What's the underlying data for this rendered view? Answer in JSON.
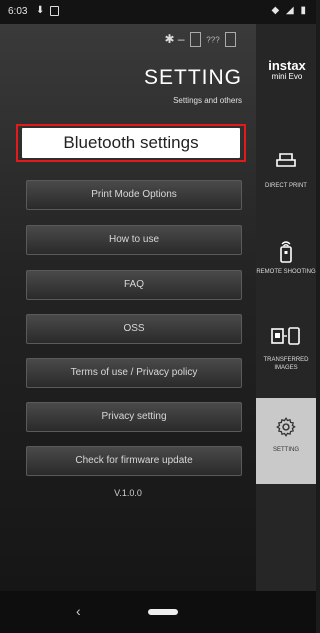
{
  "status_bar": {
    "time": "6:03",
    "download_icon": "⬇",
    "right_icons": "◆ ◢ ▮"
  },
  "header": {
    "device_text": "???",
    "title": "SETTING",
    "subtitle": "Settings and others"
  },
  "brand": {
    "line1": "instax",
    "line2": "mini Evo"
  },
  "bluetooth_button": {
    "label": "Bluetooth settings",
    "highlight_color": "#e21a1a"
  },
  "menu": [
    {
      "label": "Print Mode Options"
    },
    {
      "label": "How to use"
    },
    {
      "label": "FAQ"
    },
    {
      "label": "OSS"
    },
    {
      "label": "Terms of use / Privacy policy"
    },
    {
      "label": "Privacy setting"
    },
    {
      "label": "Check for firmware update"
    }
  ],
  "version": "V.1.0.0",
  "sidebar": [
    {
      "icon": "printer-icon",
      "label": "DIRECT PRINT"
    },
    {
      "icon": "remote-icon",
      "label": "REMOTE SHOOTING"
    },
    {
      "icon": "transfer-icon",
      "label": "TRANSFERRED IMAGES"
    },
    {
      "icon": "gear-icon",
      "label": "SETTING",
      "active": true
    }
  ],
  "nav": {
    "back_icon": "‹"
  }
}
